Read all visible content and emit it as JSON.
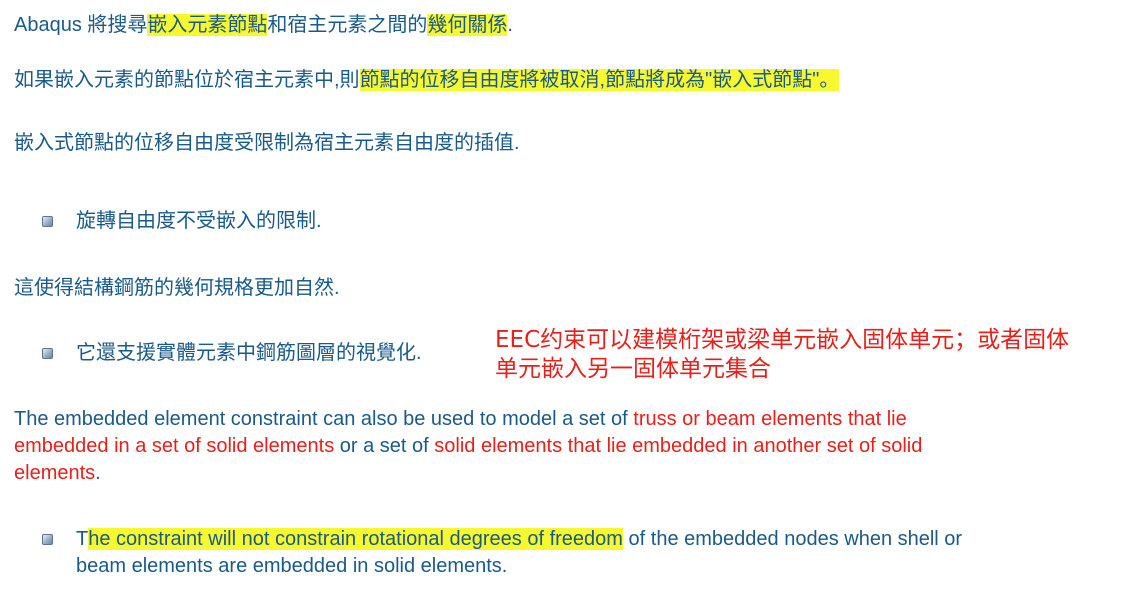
{
  "line1": {
    "a": "Abaqus 將搜尋",
    "b": "嵌入元素節點",
    "c": "和宿主元素之間的",
    "d": "幾何關係",
    "e": "."
  },
  "line2": {
    "a": "如果嵌入元素的節點位於宿主元素中,則",
    "b": "節點的位移自由度將被取消,節點將成為\"嵌入式節點\"。"
  },
  "line3": "嵌入式節點的位移自由度受限制為宿主元素自由度的插值.",
  "bullet1": "旋轉自由度不受嵌入的限制.",
  "line4": "這使得結構鋼筋的幾何規格更加自然.",
  "bullet2": "它還支援實體元素中鋼筋圖層的視覺化.",
  "note": {
    "l1": "EEC约束可以建模桁架或梁单元嵌入固体单元；或者固体",
    "l2": "单元嵌入另一固体单元集合"
  },
  "en_para": {
    "a": "The embedded element constraint can also be used to model a set of ",
    "b": "truss or beam elements that lie",
    "c": "embedded in a set of solid elements",
    "d": " or a set of ",
    "e": "solid elements that lie embedded in another set of solid",
    "f": "elements",
    "g": "."
  },
  "bullet3": {
    "a": "T",
    "b": "he constraint will not constrain rotational degrees of freedom",
    "c": " of the embedded nodes when shell  or",
    "d": "beam elements are embedded in solid elements."
  }
}
